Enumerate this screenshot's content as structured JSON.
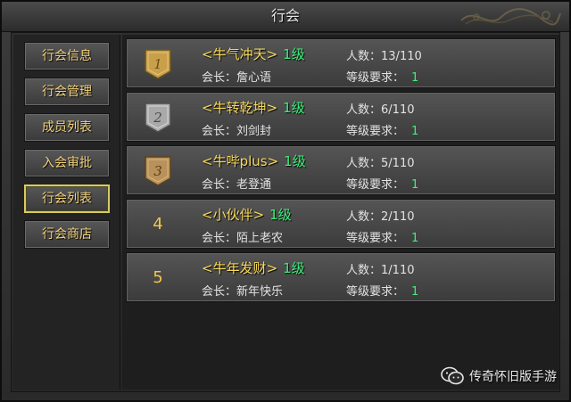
{
  "window": {
    "title": "行会"
  },
  "sidebar": {
    "items": [
      {
        "label": "行会信息",
        "active": false
      },
      {
        "label": "行会管理",
        "active": false
      },
      {
        "label": "成员列表",
        "active": false
      },
      {
        "label": "入会审批",
        "active": false
      },
      {
        "label": "行会列表",
        "active": true
      },
      {
        "label": "行会商店",
        "active": false
      }
    ]
  },
  "guilds": [
    {
      "rank": "1",
      "badge": "gold-shield-icon",
      "name": "<牛气冲天>",
      "level": "1级",
      "leader_prefix": "会长：",
      "leader": "詹心语",
      "count_label": "人数：",
      "count": "13/110",
      "req_label": "等级要求：",
      "req": "1"
    },
    {
      "rank": "2",
      "badge": "silver-shield-icon",
      "name": "<牛转乾坤>",
      "level": "1级",
      "leader_prefix": "会长：",
      "leader": "刘剑封",
      "count_label": "人数：",
      "count": "6/110",
      "req_label": "等级要求：",
      "req": "1"
    },
    {
      "rank": "3",
      "badge": "bronze-shield-icon",
      "name": "<牛哔plus>",
      "level": "1级",
      "leader_prefix": "会长：",
      "leader": "老登通",
      "count_label": "人数：",
      "count": "5/110",
      "req_label": "等级要求：",
      "req": "1"
    },
    {
      "rank": "4",
      "badge": "",
      "name": "<小伙伴>",
      "level": "1级",
      "leader_prefix": "会长：",
      "leader": "陌上老农",
      "count_label": "人数：",
      "count": "2/110",
      "req_label": "等级要求：",
      "req": "1"
    },
    {
      "rank": "5",
      "badge": "",
      "name": "<牛年发财>",
      "level": "1级",
      "leader_prefix": "会长：",
      "leader": "新年快乐",
      "count_label": "人数：",
      "count": "1/110",
      "req_label": "等级要求：",
      "req": "1"
    }
  ],
  "watermark": {
    "text": "传奇怀旧版手游",
    "icon": "wechat-icon"
  },
  "colors": {
    "gold": "#c9a04a",
    "silver": "#a9a9a9",
    "bronze": "#b8925a",
    "level_green": "#3cf07a",
    "name_yellow": "#f7d85a"
  }
}
